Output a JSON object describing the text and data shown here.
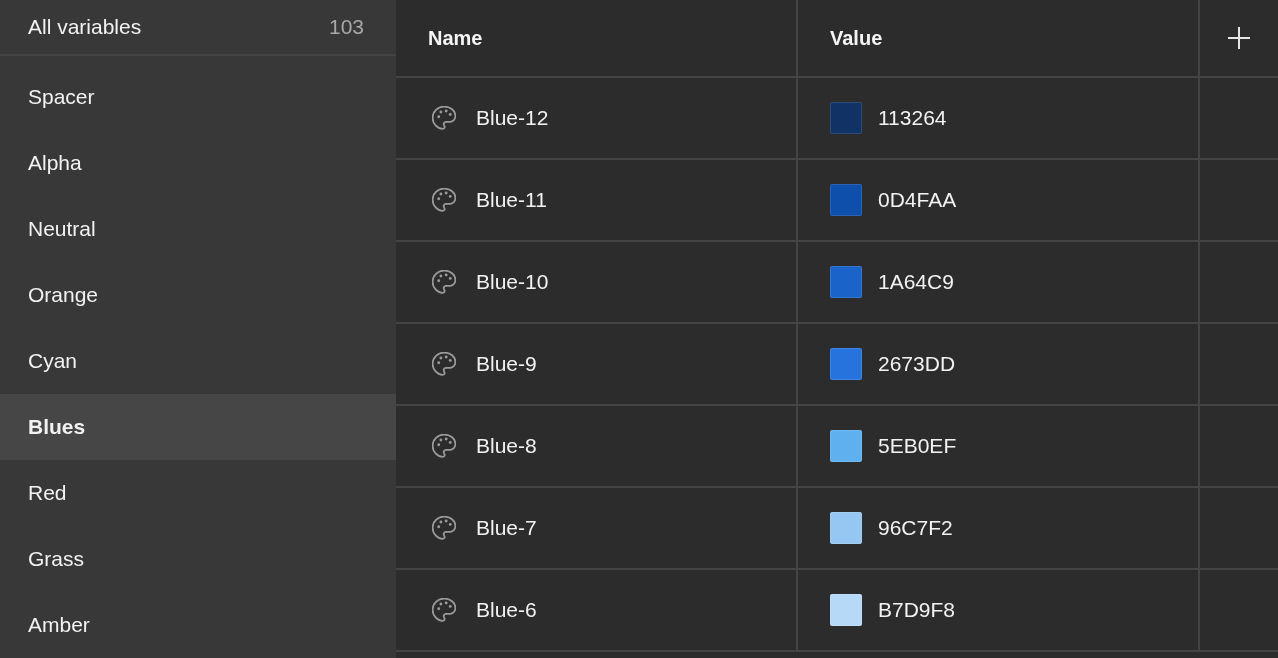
{
  "sidebar": {
    "header": {
      "label": "All variables",
      "count": "103",
      "selected": false
    },
    "items": [
      {
        "label": "Spacer",
        "selected": false
      },
      {
        "label": "Alpha",
        "selected": false
      },
      {
        "label": "Neutral",
        "selected": false
      },
      {
        "label": "Orange",
        "selected": false
      },
      {
        "label": "Cyan",
        "selected": false
      },
      {
        "label": "Blues",
        "selected": true
      },
      {
        "label": "Red",
        "selected": false
      },
      {
        "label": "Grass",
        "selected": false
      },
      {
        "label": "Amber",
        "selected": false
      }
    ]
  },
  "table": {
    "columns": [
      "Name",
      "Value"
    ],
    "rows": [
      {
        "name": "Blue-12",
        "value": "113264",
        "color": "#113264"
      },
      {
        "name": "Blue-11",
        "value": "0D4FAA",
        "color": "#0d4faa"
      },
      {
        "name": "Blue-10",
        "value": "1A64C9",
        "color": "#1a64c9"
      },
      {
        "name": "Blue-9",
        "value": "2673DD",
        "color": "#2673dd"
      },
      {
        "name": "Blue-8",
        "value": "5EB0EF",
        "color": "#5eb0ef"
      },
      {
        "name": "Blue-7",
        "value": "96C7F2",
        "color": "#96c7f2"
      },
      {
        "name": "Blue-6",
        "value": "B7D9F8",
        "color": "#b7d9f8"
      }
    ]
  }
}
